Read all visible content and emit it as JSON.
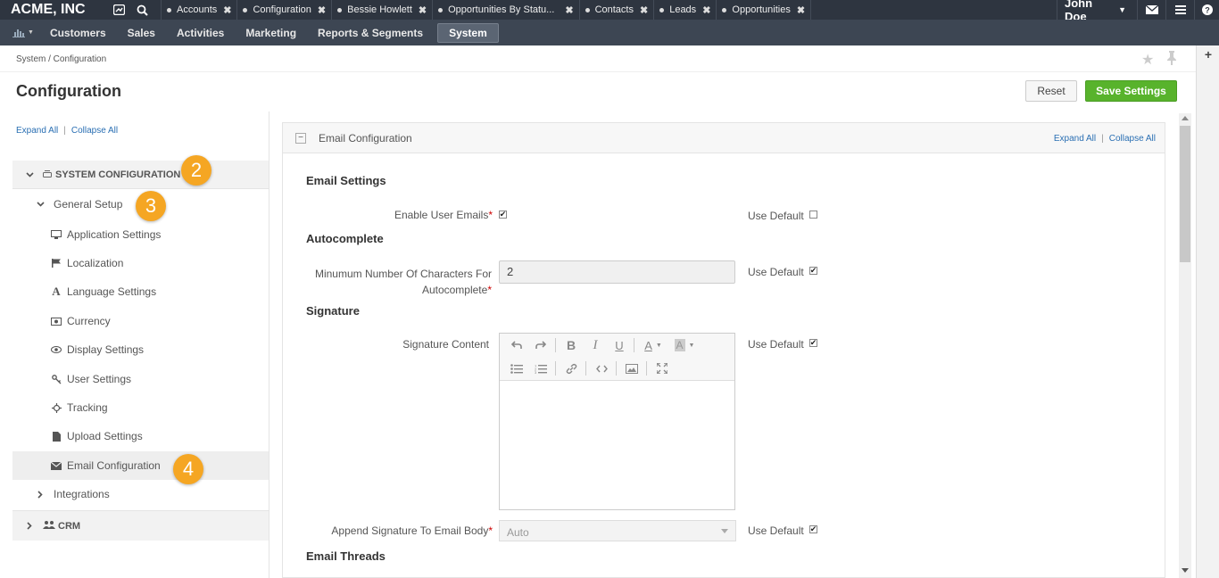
{
  "app": {
    "brand": "ACME, INC",
    "tabs": [
      {
        "label": "Accounts"
      },
      {
        "label": "Configuration"
      },
      {
        "label": "Bessie Howlett"
      },
      {
        "label": "Opportunities By Statu..."
      },
      {
        "label": "Contacts"
      },
      {
        "label": "Leads"
      },
      {
        "label": "Opportunities"
      }
    ],
    "user": "John Doe",
    "icons": {
      "dashboard": "dashboard-icon",
      "search": "search-icon",
      "mail": "mail-icon",
      "menu": "menu-icon",
      "help": "help-icon"
    }
  },
  "nav": {
    "items": [
      "Customers",
      "Sales",
      "Activities",
      "Marketing",
      "Reports & Segments",
      "System"
    ],
    "active": "System"
  },
  "page": {
    "breadcrumb": "System / Configuration",
    "title": "Configuration",
    "reset_label": "Reset",
    "save_label": "Save Settings"
  },
  "sidebar": {
    "expand_all": "Expand All",
    "collapse_all": "Collapse All",
    "separator": "|",
    "system_configuration": "SYSTEM CONFIGURATION",
    "general_setup": "General Setup",
    "items": [
      {
        "label": "Application Settings",
        "icon": "monitor-icon"
      },
      {
        "label": "Localization",
        "icon": "flag-icon"
      },
      {
        "label": "Language Settings",
        "icon": "font-icon"
      },
      {
        "label": "Currency",
        "icon": "money-icon"
      },
      {
        "label": "Display Settings",
        "icon": "eye-icon"
      },
      {
        "label": "User Settings",
        "icon": "key-icon"
      },
      {
        "label": "Tracking",
        "icon": "crosshair-icon"
      },
      {
        "label": "Upload Settings",
        "icon": "file-icon"
      },
      {
        "label": "Email Configuration",
        "icon": "envelope-icon"
      }
    ],
    "integrations": "Integrations",
    "crm": "CRM"
  },
  "badges": [
    "2",
    "3",
    "4"
  ],
  "panel": {
    "title": "Email Configuration",
    "expand_all": "Expand All",
    "collapse_all": "Collapse All",
    "separator": "|",
    "sections": {
      "email_settings": "Email Settings",
      "autocomplete": "Autocomplete",
      "signature": "Signature",
      "email_threads": "Email Threads"
    },
    "fields": {
      "enable_user_emails": "Enable User Emails",
      "min_chars_line1": "Minumum Number Of Characters For",
      "min_chars_line2": "Autocomplete",
      "min_chars_value": "2",
      "signature_content": "Signature Content",
      "append_signature": "Append Signature To Email Body",
      "append_signature_value": "Auto",
      "required_mark": "*"
    },
    "use_default": "Use Default",
    "checks": {
      "enable_user_emails": true,
      "use_default_enable": false,
      "use_default_min_chars": true,
      "use_default_signature": true,
      "use_default_append": true
    }
  },
  "colors": {
    "topbar": "#2e3540",
    "navbar": "#3d4653",
    "save_button": "#58b32c",
    "badge": "#f5a623",
    "link": "#2a6fb3"
  }
}
